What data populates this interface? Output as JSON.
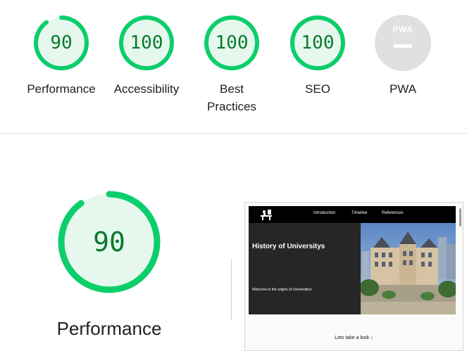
{
  "gauges": [
    {
      "score": "90",
      "label": "Performance",
      "value": 90
    },
    {
      "score": "100",
      "label": "Accessibility",
      "value": 100
    },
    {
      "score": "100",
      "label": "Best Practices",
      "value": 100
    },
    {
      "score": "100",
      "label": "SEO",
      "value": 100
    },
    {
      "score": "",
      "label": "PWA",
      "badge": "PWA"
    }
  ],
  "colors": {
    "pass": "#0cce6b",
    "pass_fill": "#e6f8ee",
    "pass_text": "#0a7a2a",
    "na": "#e0e0e0"
  },
  "detail": {
    "score": "90",
    "value": 90,
    "label": "Performance"
  },
  "screenshot": {
    "nav_links": [
      "Introduction",
      "Timeline",
      "References"
    ],
    "hero_title": "History of Universitys",
    "hero_subtitle": "Welcome to the origins of Universities!",
    "cta": "Lets take a look ↓"
  }
}
